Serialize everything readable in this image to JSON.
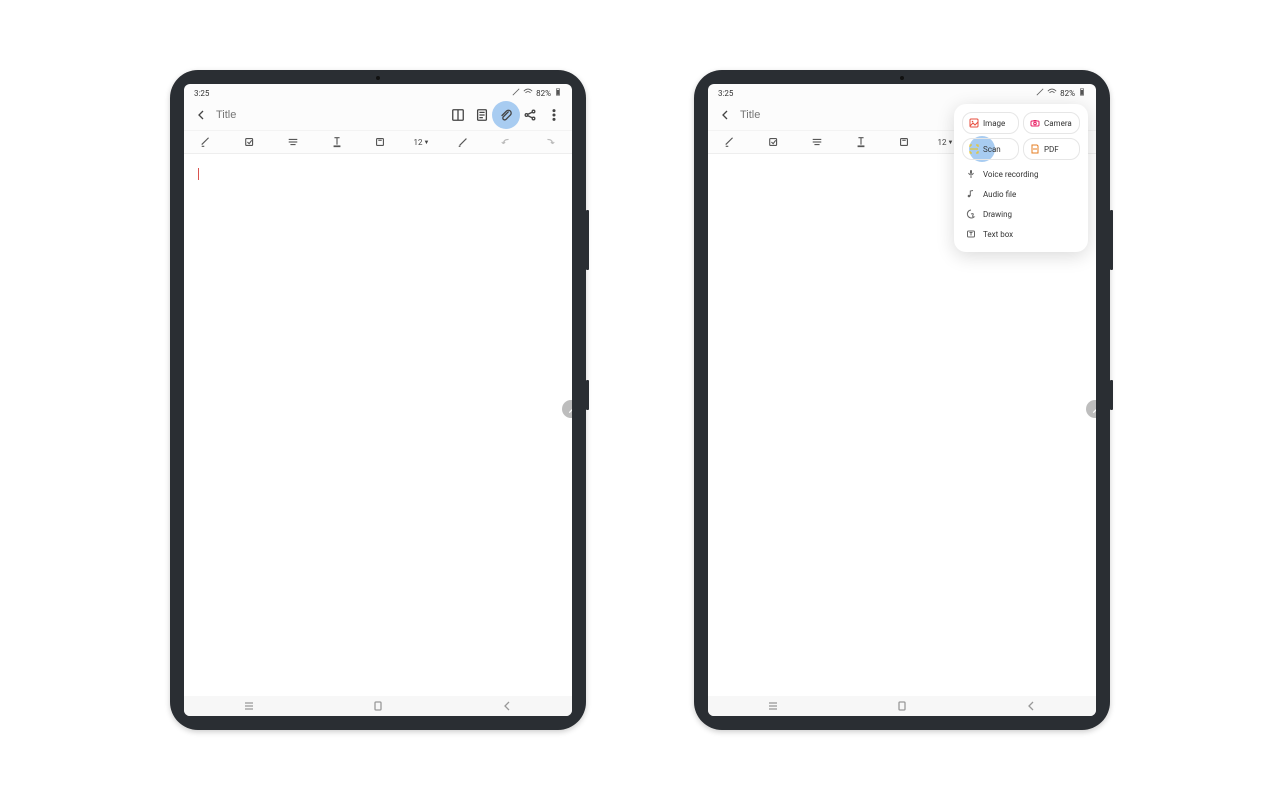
{
  "status": {
    "time": "3:25",
    "battery": "82%"
  },
  "header": {
    "title_placeholder": "Title"
  },
  "toolbar": {
    "font_size": "12"
  },
  "attach_menu": {
    "image": "Image",
    "camera": "Camera",
    "scan": "Scan",
    "pdf": "PDF",
    "voice": "Voice recording",
    "audio": "Audio file",
    "drawing": "Drawing",
    "textbox": "Text box"
  }
}
